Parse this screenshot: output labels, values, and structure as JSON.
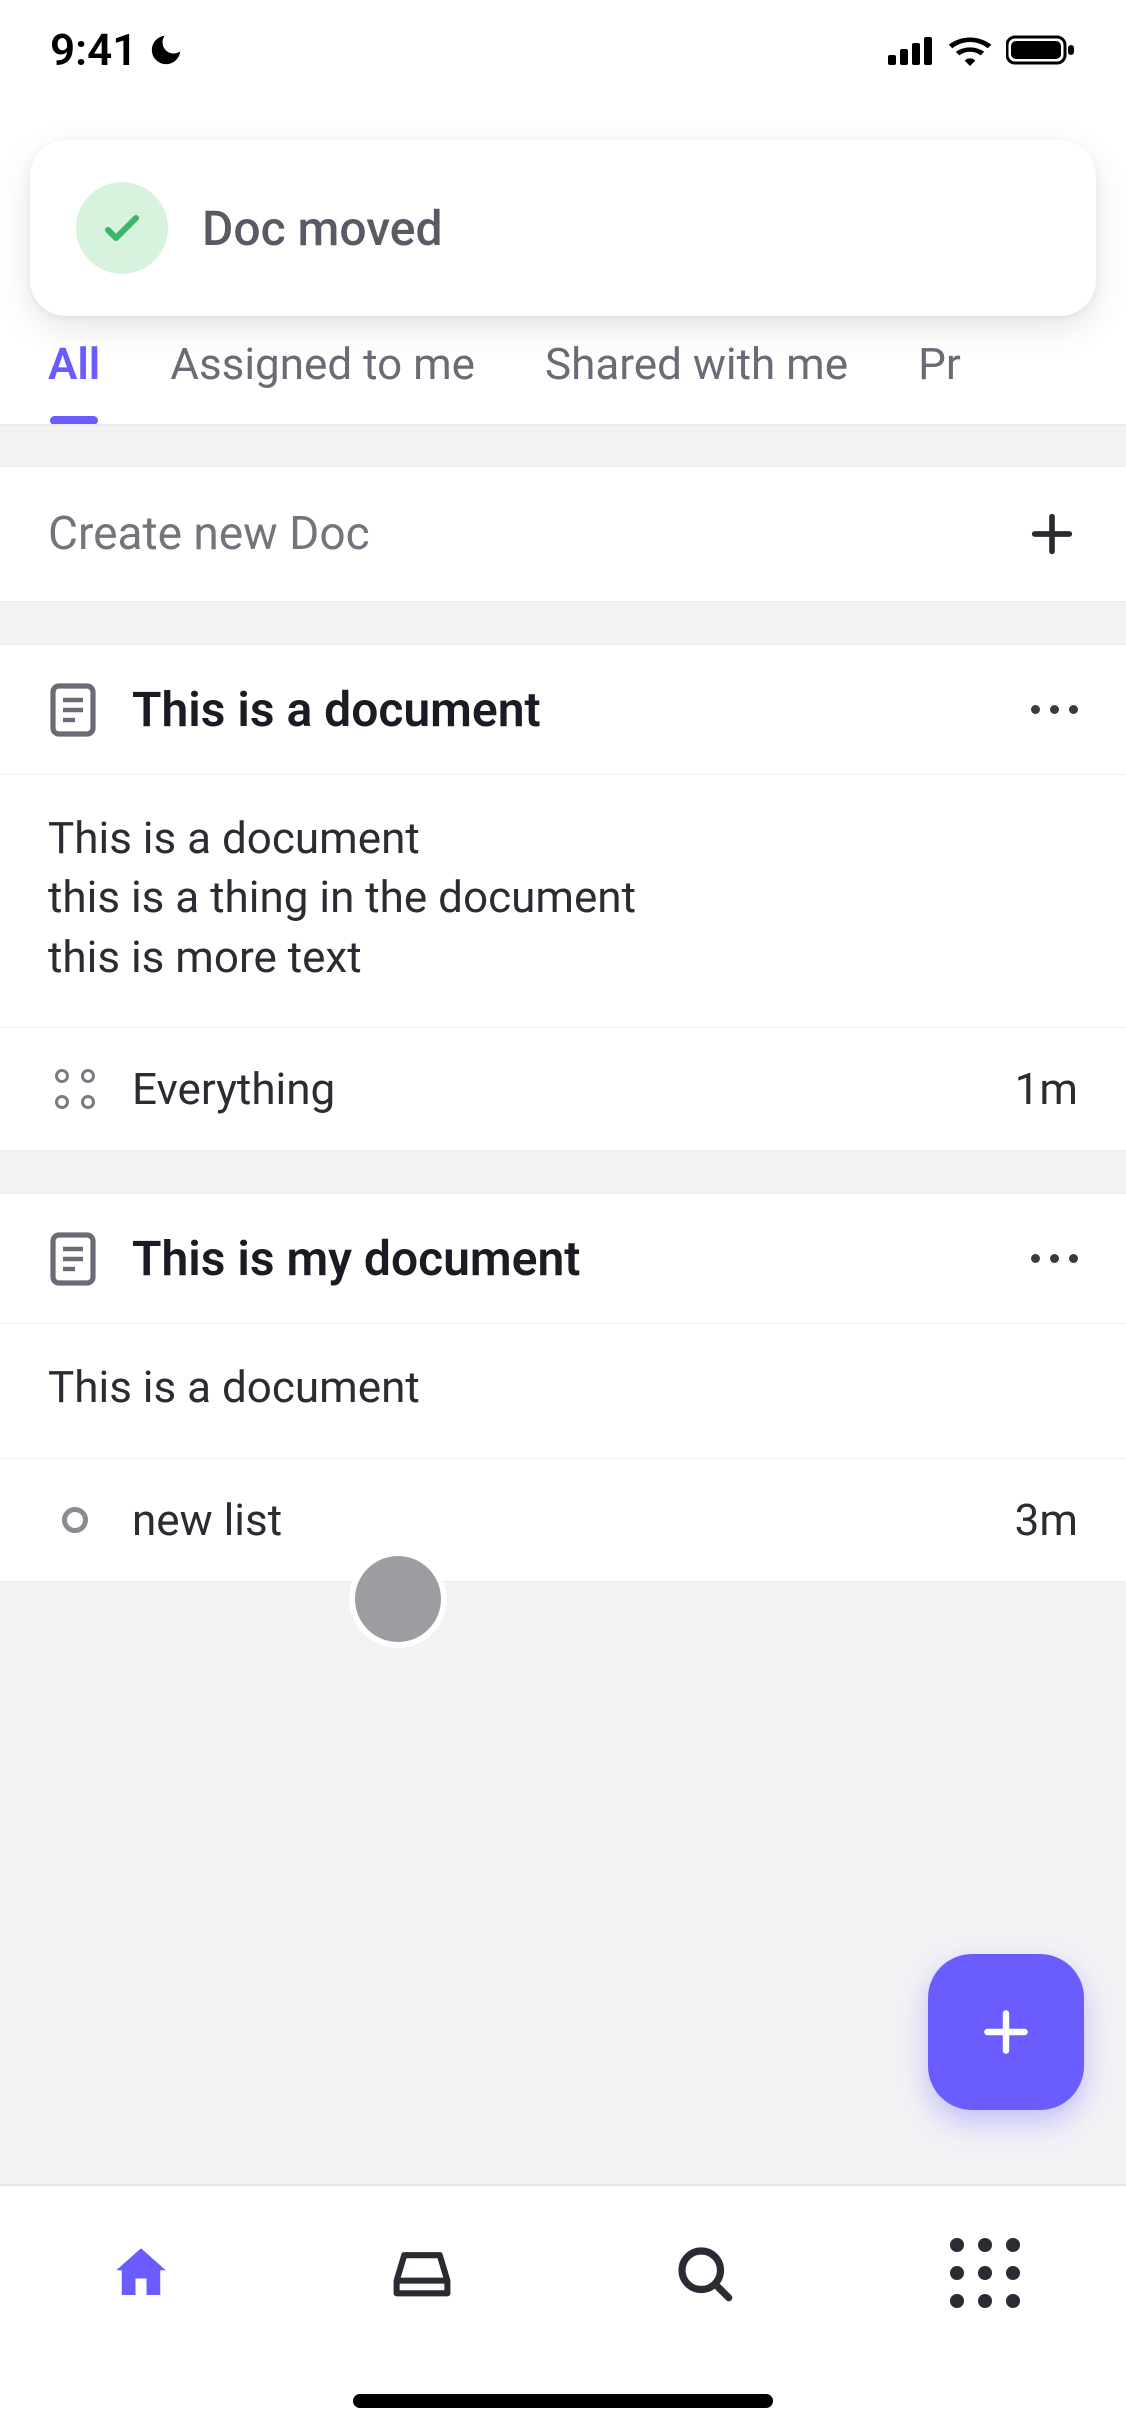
{
  "status_bar": {
    "time": "9:41"
  },
  "toast": {
    "message": "Doc moved"
  },
  "tabs": {
    "items": [
      {
        "label": "All",
        "active": true
      },
      {
        "label": "Assigned to me",
        "active": false
      },
      {
        "label": "Shared with me",
        "active": false
      },
      {
        "label": "Pr",
        "active": false
      }
    ]
  },
  "create": {
    "label": "Create new Doc"
  },
  "docs": [
    {
      "title": "This is a document",
      "body": [
        "This is a document",
        "this is a thing in the document",
        "this is more text"
      ],
      "location": {
        "label": "Everything",
        "icon": "four-dots"
      },
      "time": "1m"
    },
    {
      "title": "This is my document",
      "body": [
        "This is a document"
      ],
      "location": {
        "label": "new list",
        "icon": "ring"
      },
      "time": "3m"
    }
  ],
  "colors": {
    "accent": "#6a5cff",
    "success_bg": "#d7f3de",
    "text_muted": "#74747e"
  }
}
